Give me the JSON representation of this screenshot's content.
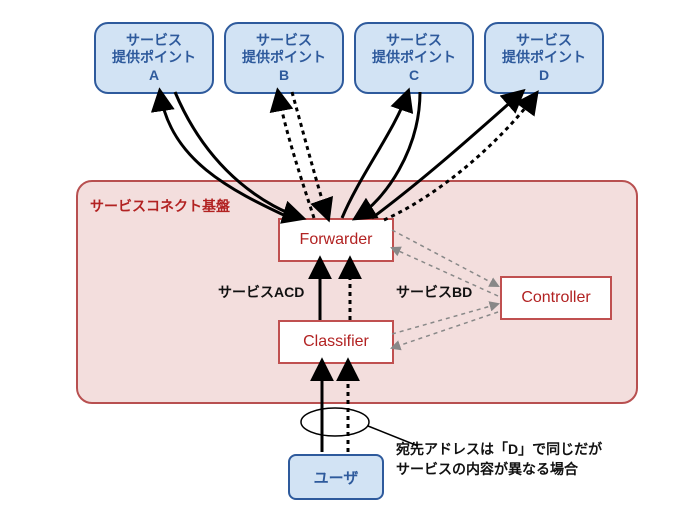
{
  "service_points": {
    "a": "サービス\n提供ポイント\nA",
    "b": "サービス\n提供ポイント\nB",
    "c": "サービス\n提供ポイント\nC",
    "d": "サービス\n提供ポイント\nD"
  },
  "platform": {
    "title": "サービスコネクト基盤",
    "forwarder": "Forwarder",
    "classifier": "Classifier",
    "controller": "Controller"
  },
  "labels": {
    "service_acd": "サービスACD",
    "service_bd": "サービスBD"
  },
  "note": "宛先アドレスは「D」で同じだが\nサービスの内容が異なる場合",
  "user": "ユーザ",
  "colors": {
    "blue_border": "#2e5a9c",
    "blue_fill": "#d2e3f4",
    "red_border": "#c05050",
    "red_fill": "#f3dedd",
    "red_text": "#b22222"
  }
}
